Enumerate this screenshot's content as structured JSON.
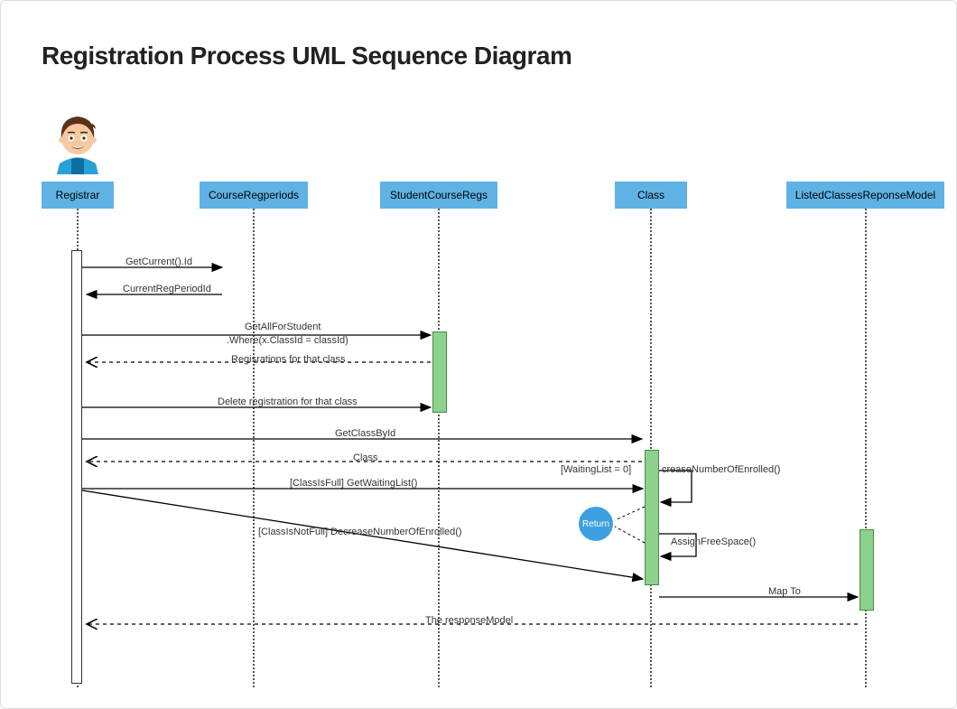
{
  "title": "Registration Process UML Sequence Diagram",
  "lifelines": {
    "registrar": "Registrar",
    "courseRegPeriods": "CourseRegperiods",
    "studentCourseRegs": "StudentCourseRegs",
    "class": "Class",
    "listedClassesResponseModel": "ListedClassesReponseModel"
  },
  "messages": {
    "m1": "GetCurrent().Id",
    "m2": "CurrentRegPeriodId",
    "m3a": "GetAllForStudent",
    "m3b": ".Where(x.ClassId = classId)",
    "m4": "Regisrations for that class",
    "m5": "Delete registration for that class",
    "m6": "GetClassById",
    "m7": "Class",
    "m8a": "[WaitingList = 0]",
    "m8b": "creaseNumberOfEnrolled()",
    "m9": "[ClassIsFull] GetWaitingList()",
    "m10": "Return",
    "m11": "AssignFreeSpace()",
    "m12": "[ClassIsNotFull] DecreaseNumberOfEnrolled()",
    "m13": "Map To",
    "m14": "The responseModel"
  },
  "colors": {
    "lifelineHead": "#5eb3e4",
    "activationGreen": "#8cd18c",
    "returnCircle": "#3ea0e0"
  }
}
